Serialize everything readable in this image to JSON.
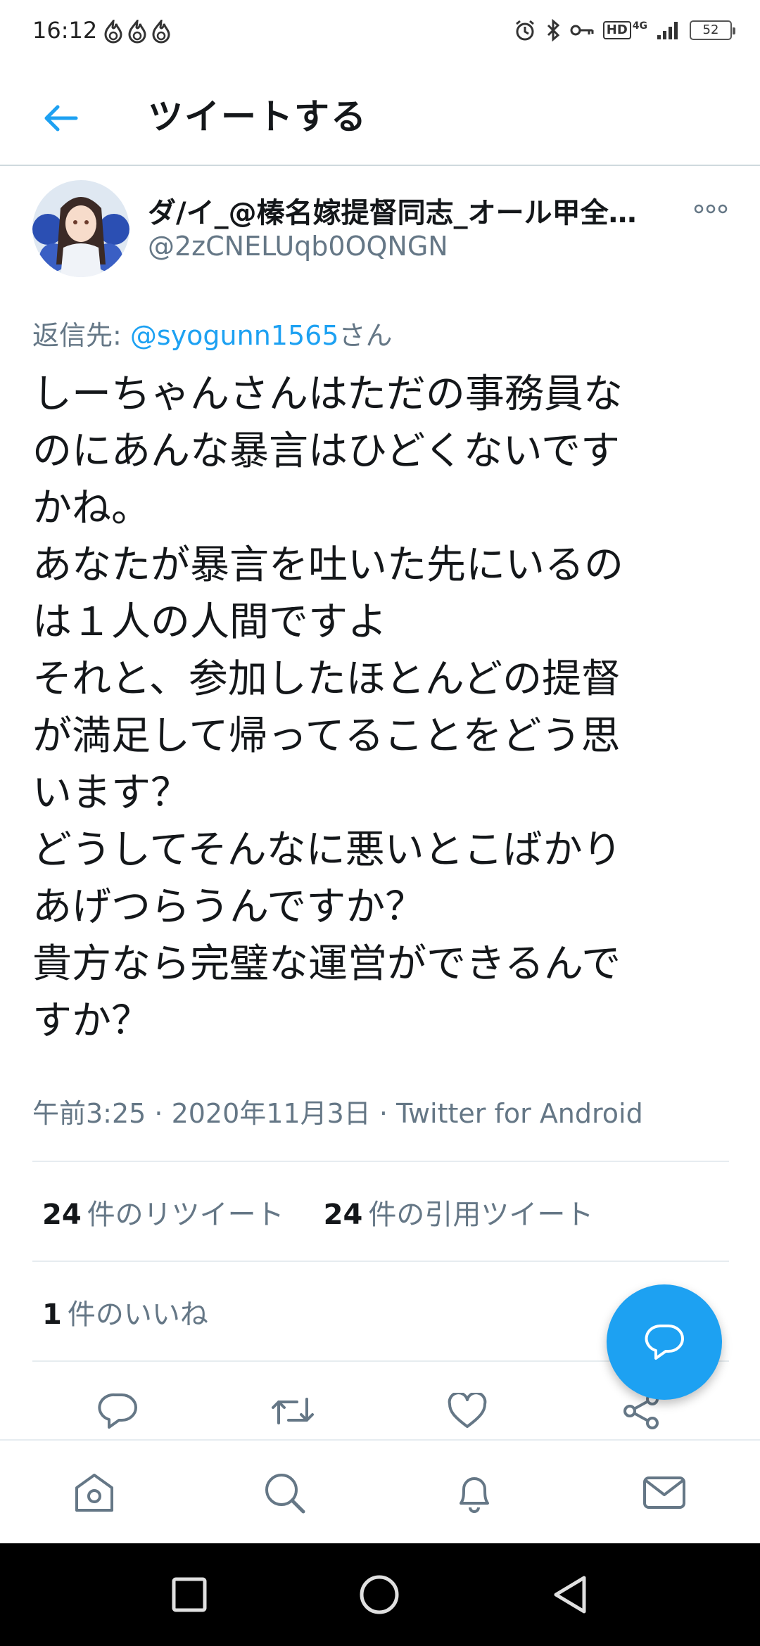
{
  "status_bar": {
    "time": "16:12",
    "network": "4G",
    "hd": "HD",
    "battery": "52"
  },
  "header": {
    "title": "ツイートする",
    "back_icon": "arrow-left-icon"
  },
  "tweet": {
    "display_name": "ダ/イ_@榛名嫁提督同志_オール甲全…",
    "handle": "@2zCNELUqb0OQNGN",
    "reply_prefix": "返信先: ",
    "reply_mention": "@syogunn1565",
    "reply_suffix": "さん",
    "text": "しーちゃんさんはただの事務員な\nのにあんな暴言はひどくないです\nかね。\nあなたが暴言を吐いた先にいるの\nは１人の人間ですよ\nそれと、参加したほとんどの提督\nが満足して帰ってることをどう思\nいます？\nどうしてそんなに悪いとこばかり\nあげつらうんですか？\n貴方なら完璧な運営ができるんで\nすか？",
    "meta": "午前3:25 · 2020年11月3日 · Twitter for Android"
  },
  "stats": {
    "retweets_count": "24",
    "retweets_label": "件のリツイート",
    "quotes_count": "24",
    "quotes_label": "件の引用ツイート",
    "likes_count": "1",
    "likes_label": "件のいいね"
  },
  "actions": [
    "reply-icon",
    "retweet-icon",
    "like-icon",
    "share-icon"
  ],
  "bottom_nav": [
    "home-icon",
    "search-icon",
    "notifications-icon",
    "messages-icon"
  ],
  "colors": {
    "accent": "#1da1f2",
    "text_primary": "#14171a",
    "text_secondary": "#657786",
    "divider": "#e6ecf0"
  }
}
